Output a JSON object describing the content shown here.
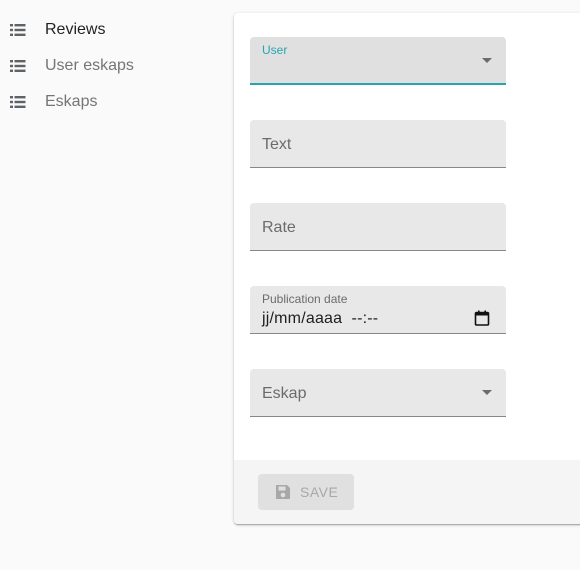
{
  "sidebar": {
    "items": [
      {
        "label": "Reviews",
        "icon": "list-icon"
      },
      {
        "label": "User eskaps",
        "icon": "list-icon"
      },
      {
        "label": "Eskaps",
        "icon": "list-icon"
      }
    ]
  },
  "form": {
    "user": {
      "label": "User",
      "value": ""
    },
    "text": {
      "placeholder": "Text"
    },
    "rate": {
      "placeholder": "Rate"
    },
    "publication_date": {
      "label": "Publication date",
      "value": "jj/mm/aaaa  --:--"
    },
    "eskap": {
      "placeholder": "Eskap"
    }
  },
  "toolbar": {
    "save_label": "SAVE"
  },
  "colors": {
    "accent": "#26a5b0",
    "background": "#fafafa"
  }
}
